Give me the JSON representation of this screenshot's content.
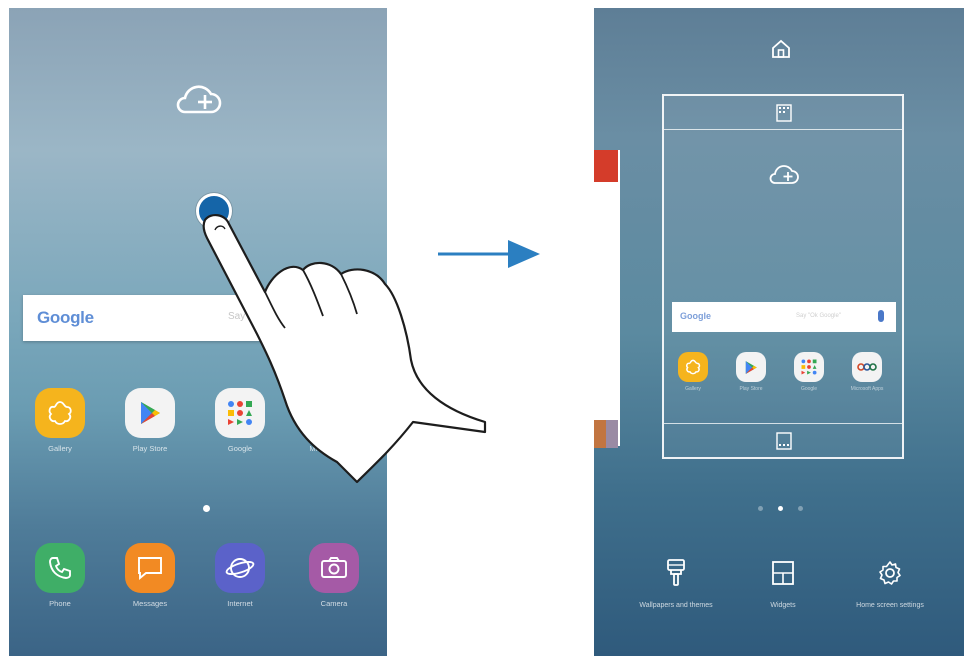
{
  "left_screen": {
    "search": {
      "logo": "Google",
      "hint": "Say \"Ok G"
    },
    "apps": [
      {
        "label": "Gallery",
        "icon": "gallery-icon",
        "color": "#f5b41d"
      },
      {
        "label": "Play Store",
        "icon": "play-store-icon",
        "color": "#f3f3f3"
      },
      {
        "label": "Google",
        "icon": "google-folder-icon",
        "color": "#f3f3f3"
      },
      {
        "label": "Microsoft Apps",
        "icon": "microsoft-folder-icon",
        "color": "#f3f3f3"
      }
    ],
    "dock": [
      {
        "label": "Phone",
        "icon": "phone-icon",
        "color": "#3fae67"
      },
      {
        "label": "Messages",
        "icon": "messages-icon",
        "color": "#f28a23"
      },
      {
        "label": "Internet",
        "icon": "internet-icon",
        "color": "#5b62c9"
      },
      {
        "label": "Camera",
        "icon": "camera-icon",
        "color": "#a55aa6"
      }
    ]
  },
  "right_screen": {
    "preview": {
      "search": {
        "logo": "Google",
        "hint": "Say \"Ok Google\""
      },
      "apps": [
        {
          "label": "Gallery",
          "icon": "gallery-icon",
          "color": "#f5b41d"
        },
        {
          "label": "Play Store",
          "icon": "play-store-icon",
          "color": "#f3f3f3"
        },
        {
          "label": "Google",
          "icon": "google-folder-icon",
          "color": "#f3f3f3"
        },
        {
          "label": "Microsoft Apps",
          "icon": "microsoft-folder-icon",
          "color": "#f3f3f3"
        }
      ]
    },
    "edit_options": [
      {
        "label": "Wallpapers and themes",
        "icon": "paint-brush-icon"
      },
      {
        "label": "Widgets",
        "icon": "widgets-icon"
      },
      {
        "label": "Home screen settings",
        "icon": "gear-icon"
      }
    ]
  },
  "colors": {
    "touch_point": "#1565a8",
    "arrow": "#2b7fc1"
  }
}
